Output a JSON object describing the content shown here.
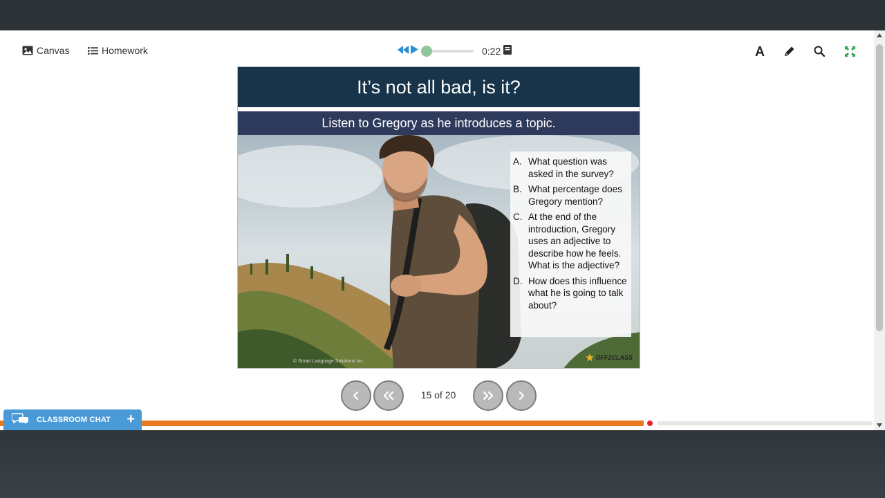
{
  "header": {
    "canvas_label": "Canvas",
    "homework_label": "Homework",
    "audio_time": "0:22"
  },
  "toolbar": {
    "icons": [
      "font-icon",
      "pencil-icon",
      "search-icon",
      "fullscreen-icon"
    ],
    "fullscreen_color": "#2aa84a"
  },
  "slide": {
    "title": "It’s not all bad, is it?",
    "subtitle": "Listen to Gregory as he introduces a topic.",
    "questions": [
      {
        "letter": "A.",
        "text": "What question was asked in the survey?"
      },
      {
        "letter": "B.",
        "text": "What percentage does Gregory mention?"
      },
      {
        "letter": "C.",
        "text": "At the end of the introduction, Gregory uses an adjective to describe how he feels. What is the adjective?"
      },
      {
        "letter": "D.",
        "text": "How does this influence what he is going to talk about?"
      }
    ],
    "logo": "OFF2CLASS",
    "copyright": "© Smart Language Solutions Inc."
  },
  "pager": {
    "current": "15 of 20"
  },
  "progress": {
    "fraction": 0.74
  },
  "chat": {
    "label": "CLASSROOM CHAT",
    "plus": "+"
  },
  "colors": {
    "title_bg": "#17344a",
    "subtitle_bg": "#2e3a5c",
    "progress": "#ea7a1e",
    "chat": "#4a9ad8",
    "audio": "#2a8fd6"
  }
}
